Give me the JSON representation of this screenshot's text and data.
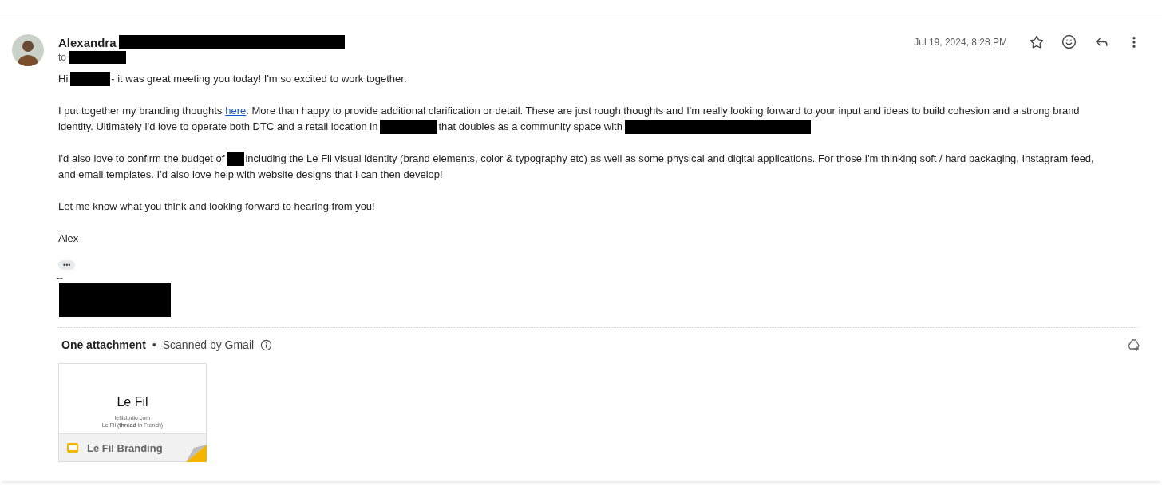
{
  "sender": [
    {
      "kind": "text",
      "text": "Alexandra"
    },
    {
      "kind": "redacted"
    }
  ],
  "recipient": [
    {
      "kind": "text",
      "text": "to"
    },
    {
      "kind": "redacted"
    }
  ],
  "date": "Jul 19, 2024, 8:28 PM",
  "paragraphs": [
    [
      [
        {
          "kind": "text",
          "text": "Hi"
        },
        {
          "kind": "redacted"
        },
        {
          "kind": "text",
          "text": "- it was great meeting you today! I'm so excited to work together."
        }
      ]
    ],
    [
      [
        {
          "kind": "text",
          "text": "I put together my branding thoughts"
        },
        {
          "kind": "link",
          "text": "here"
        },
        {
          "kind": "text",
          "text": ". More than happy to provide additional clarification or detail. These are just rough thoughts and I'm really looking forward to your input and ideas to build cohesion and a strong brand"
        }
      ],
      [
        {
          "kind": "text",
          "text": "identity. Ultimately I'd love to operate both DTC and a retail location in"
        },
        {
          "kind": "redacted"
        },
        {
          "kind": "text",
          "text": "that doubles as a community space with"
        },
        {
          "kind": "redacted"
        }
      ]
    ],
    [
      [
        {
          "kind": "text",
          "text": "I'd also love to confirm the budget of"
        },
        {
          "kind": "redacted"
        },
        {
          "kind": "text",
          "text": "including the Le Fil visual identity (brand elements, color & typography etc) as well as some physical and digital applications. For those I'm thinking soft / hard packaging, Instagram feed,"
        }
      ],
      [
        {
          "kind": "text",
          "text": "and email templates. I'd also love help with website designs that I can then develop!"
        }
      ]
    ],
    [
      [
        {
          "kind": "text",
          "text": "Let me know what you think and looking forward to hearing from you!"
        }
      ]
    ],
    [
      [
        {
          "kind": "text",
          "text": "Alex"
        }
      ]
    ]
  ],
  "trimmed_button": "•••",
  "signature": [
    {
      "kind": "text",
      "text": "--"
    },
    {
      "kind": "redacted"
    }
  ],
  "attachments": {
    "title": "One attachment",
    "separator": "•",
    "scan_note": "Scanned by Gmail",
    "files": [
      {
        "slide_title": "Le Fil",
        "slide_url": "lefilstudio.com",
        "slide_caption": "Le Fil (**thread** in French)",
        "name": "Le Fil Branding"
      }
    ]
  }
}
